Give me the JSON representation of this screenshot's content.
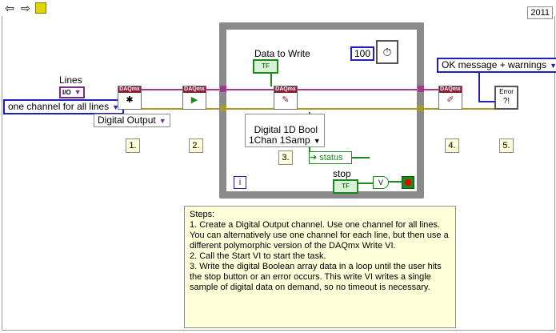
{
  "toolbar": {
    "run": "⇦",
    "arrow": "⇨",
    "run_icon": "run-arrow-icon",
    "year": "2011"
  },
  "controls": {
    "lines_label": "Lines",
    "lines_io": "I/O",
    "channel_mode": "one channel for all lines",
    "digital_output": "Digital Output",
    "message_mode": "OK message + warnings",
    "poly_write": "Digital 1D Bool\n1Chan 1Samp"
  },
  "vis": {
    "daqmx": "DAQmx",
    "error_label": "Error"
  },
  "steps": [
    "1.",
    "2.",
    "3.",
    "4.",
    "5."
  ],
  "loop": {
    "data_to_write": "Data to Write",
    "bool_const": "TF",
    "wait_ms": "100",
    "status_label": "status",
    "stop_label": "stop",
    "or_label": "V",
    "iteration": "i"
  },
  "notes": {
    "title": "Steps:",
    "lines": [
      "1.   Create a Digital Output channel.  Use one channel for all lines.  You can alternatively use one channel for each line, but then use a different polymorphic version of the DAQmx Write VI.",
      "2.  Call the Start VI to start the task.",
      "3.  Write the digital Boolean array data in a loop until the user hits the stop button or an error occurs.  This write VI writes a single sample of digital data on demand, so no timeout is necessary."
    ]
  },
  "colors": {
    "task_wire": "#a6378f",
    "error_wire": "#a69a2a",
    "bool_wire": "#1b8a1b",
    "dbl_wire": "#f07c00"
  }
}
